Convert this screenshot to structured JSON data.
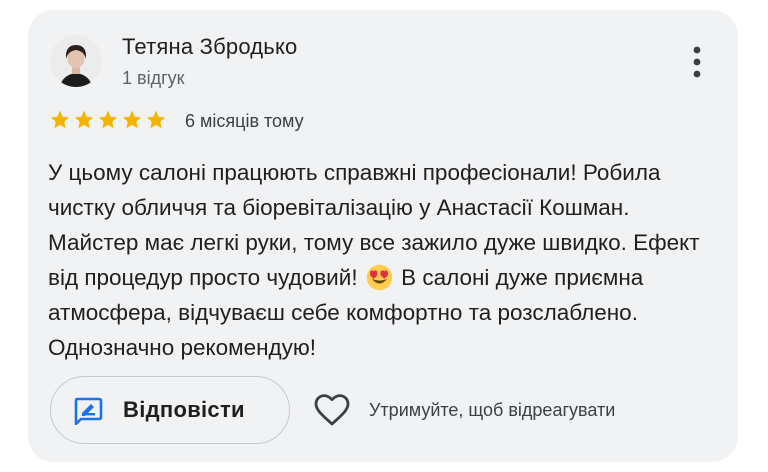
{
  "review": {
    "author_name": "Тетяна Збродько",
    "author_reviews": "1 відгук",
    "rating": 5,
    "rating_max": 5,
    "time_ago": "6 місяців тому",
    "text_part1": "У цьому салоні працюють справжні професіонали! Робила чистку обличчя та біоревіталізацію у Анастасії Кошман. Майстер має легкі руки, тому все зажило дуже швидко. Ефект від процедур просто чудовий!",
    "text_part2": " В салоні дуже приємна атмосфера, відчуваєш себе комфортно та розслаблено. Однозначно рекомендую!",
    "emoji": "heart-eyes-emoji"
  },
  "actions": {
    "reply_label": "Відповісти",
    "like_hint": "Утримуйте, щоб відреагувати"
  },
  "icons": {
    "more": "more-vert-icon",
    "star": "star-icon",
    "reply": "reply-edit-icon",
    "like": "heart-outline-icon"
  },
  "colors": {
    "card_bg": "#f1f2f4",
    "star": "#f5b400",
    "reply_icon": "#1a73e8",
    "text": "#1f1f1f",
    "muted": "#5f6368"
  }
}
